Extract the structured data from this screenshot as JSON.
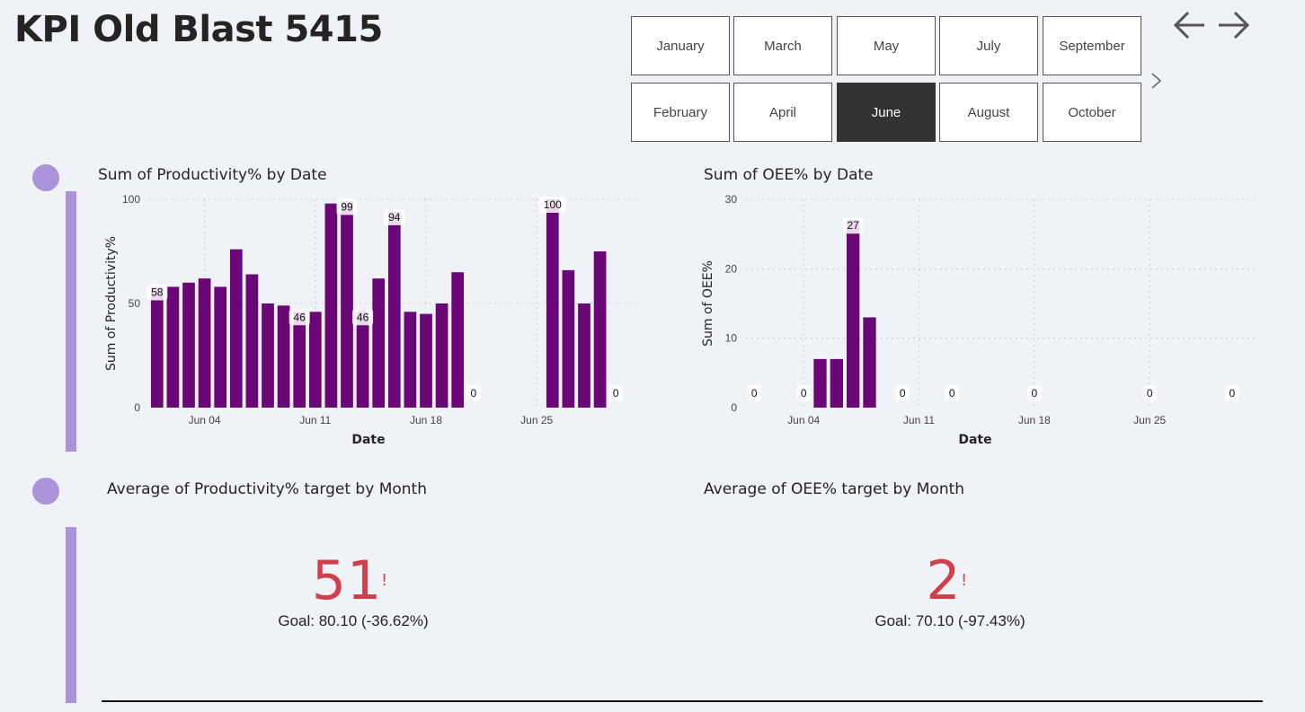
{
  "page": {
    "title": "KPI Old Blast 5415"
  },
  "slicer": {
    "months": [
      "January",
      "March",
      "May",
      "July",
      "September",
      "February",
      "April",
      "June",
      "August",
      "October"
    ],
    "selected": "June"
  },
  "colors": {
    "bar": "#6b0677",
    "accent": "#ab93d9",
    "kpi": "#d1404a",
    "selected_bg": "#333333"
  },
  "icons": {
    "back": "arrow-left-icon",
    "forward": "arrow-right-icon",
    "slicer_next": "chevron-right-icon"
  },
  "chart_data": [
    {
      "type": "bar",
      "title": "Sum of Productivity% by Date",
      "xlabel": "Date",
      "ylabel": "Sum of Productivity%",
      "ylim": [
        0,
        100
      ],
      "yticks": [
        "0",
        "50",
        "100"
      ],
      "x_range": [
        "2024-06-01",
        "2024-06-30"
      ],
      "xticks": [
        {
          "date": "2024-06-04",
          "label": "Jun 04"
        },
        {
          "date": "2024-06-11",
          "label": "Jun 11"
        },
        {
          "date": "2024-06-18",
          "label": "Jun 18"
        },
        {
          "date": "2024-06-25",
          "label": "Jun 25"
        }
      ],
      "grid": true,
      "points": [
        {
          "date": "2024-06-01",
          "value": 58,
          "label": "58"
        },
        {
          "date": "2024-06-02",
          "value": 58
        },
        {
          "date": "2024-06-03",
          "value": 60
        },
        {
          "date": "2024-06-04",
          "value": 62
        },
        {
          "date": "2024-06-05",
          "value": 58
        },
        {
          "date": "2024-06-06",
          "value": 76
        },
        {
          "date": "2024-06-07",
          "value": 64
        },
        {
          "date": "2024-06-08",
          "value": 50
        },
        {
          "date": "2024-06-09",
          "value": 49
        },
        {
          "date": "2024-06-10",
          "value": 46,
          "label": "46"
        },
        {
          "date": "2024-06-11",
          "value": 46
        },
        {
          "date": "2024-06-12",
          "value": 98
        },
        {
          "date": "2024-06-13",
          "value": 99,
          "label": "99"
        },
        {
          "date": "2024-06-14",
          "value": 46,
          "label": "46"
        },
        {
          "date": "2024-06-15",
          "value": 62
        },
        {
          "date": "2024-06-16",
          "value": 94,
          "label": "94"
        },
        {
          "date": "2024-06-17",
          "value": 46
        },
        {
          "date": "2024-06-18",
          "value": 45
        },
        {
          "date": "2024-06-19",
          "value": 50
        },
        {
          "date": "2024-06-20",
          "value": 65
        },
        {
          "date": "2024-06-21",
          "value": 0,
          "label": "0"
        },
        {
          "date": "2024-06-26",
          "value": 100,
          "label": "100"
        },
        {
          "date": "2024-06-27",
          "value": 66
        },
        {
          "date": "2024-06-28",
          "value": 50
        },
        {
          "date": "2024-06-29",
          "value": 75
        },
        {
          "date": "2024-06-30",
          "value": 0,
          "label": "0"
        }
      ]
    },
    {
      "type": "bar",
      "title": "Sum of OEE% by Date",
      "xlabel": "Date",
      "ylabel": "Sum of OEE%",
      "ylim": [
        0,
        30
      ],
      "yticks": [
        "0",
        "10",
        "20",
        "30"
      ],
      "x_range": [
        "2024-06-01",
        "2024-06-30"
      ],
      "xticks": [
        {
          "date": "2024-06-04",
          "label": "Jun 04"
        },
        {
          "date": "2024-06-11",
          "label": "Jun 11"
        },
        {
          "date": "2024-06-18",
          "label": "Jun 18"
        },
        {
          "date": "2024-06-25",
          "label": "Jun 25"
        }
      ],
      "grid": true,
      "points": [
        {
          "date": "2024-06-01",
          "value": 0,
          "label": "0"
        },
        {
          "date": "2024-06-04",
          "value": 0,
          "label": "0"
        },
        {
          "date": "2024-06-05",
          "value": 7
        },
        {
          "date": "2024-06-06",
          "value": 7
        },
        {
          "date": "2024-06-07",
          "value": 27,
          "label": "27"
        },
        {
          "date": "2024-06-08",
          "value": 13
        },
        {
          "date": "2024-06-10",
          "value": 0,
          "label": "0"
        },
        {
          "date": "2024-06-13",
          "value": 0,
          "label": "0"
        },
        {
          "date": "2024-06-18",
          "value": 0,
          "label": "0"
        },
        {
          "date": "2024-06-25",
          "value": 0,
          "label": "0"
        },
        {
          "date": "2024-06-30",
          "value": 0,
          "label": "0"
        }
      ]
    }
  ],
  "cards": [
    {
      "title": "Average of Productivity% target by Month",
      "value": "51",
      "alert": "!",
      "goal": "Goal: 80.10 (-36.62%)"
    },
    {
      "title": "Average of OEE% target by Month",
      "value": "2",
      "alert": "!",
      "goal": "Goal: 70.10 (-97.43%)"
    }
  ]
}
